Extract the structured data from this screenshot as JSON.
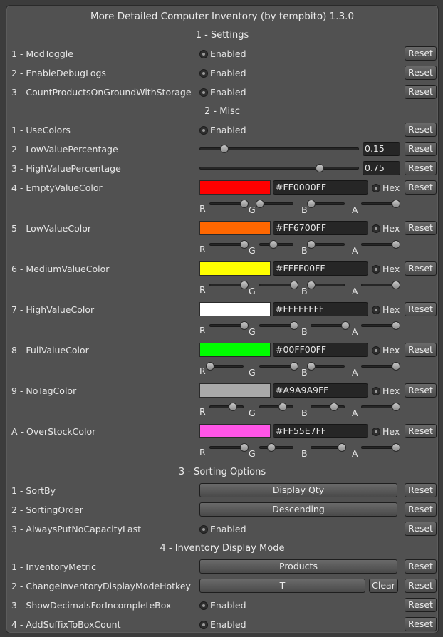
{
  "title": "More Detailed Computer Inventory (by tempbito) 1.3.0",
  "reset_label": "Reset",
  "enabled_label": "Enabled",
  "hex_label": "Hex",
  "channels": [
    "R",
    "G",
    "B",
    "A"
  ],
  "sections": {
    "settings": {
      "heading": "1 - Settings",
      "items": [
        {
          "label": "1 - ModToggle"
        },
        {
          "label": "2 - EnableDebugLogs"
        },
        {
          "label": "3 - CountProductsOnGroundWithStorage"
        }
      ]
    },
    "misc": {
      "heading": "2 - Misc",
      "use_colors": {
        "label": "1 - UseColors"
      },
      "low_value": {
        "label": "2 - LowValuePercentage",
        "value": "0.15",
        "fraction": 0.15
      },
      "high_value": {
        "label": "3 - HighValuePercentage",
        "value": "0.75",
        "fraction": 0.75
      },
      "colors": [
        {
          "label": "4 - EmptyValueColor",
          "hex": "#FF0000FF",
          "swatch": "#ff0000",
          "rgba": [
            1.0,
            0.0,
            0.0,
            1.0
          ]
        },
        {
          "label": "5 - LowValueColor",
          "hex": "#FF6700FF",
          "swatch": "#ff6700",
          "rgba": [
            1.0,
            0.4,
            0.0,
            1.0
          ]
        },
        {
          "label": "6 - MediumValueColor",
          "hex": "#FFFF00FF",
          "swatch": "#ffff00",
          "rgba": [
            1.0,
            1.0,
            0.0,
            1.0
          ]
        },
        {
          "label": "7 - HighValueColor",
          "hex": "#FFFFFFFF",
          "swatch": "#ffffff",
          "rgba": [
            1.0,
            1.0,
            1.0,
            1.0
          ]
        },
        {
          "label": "8 - FullValueColor",
          "hex": "#00FF00FF",
          "swatch": "#00ff00",
          "rgba": [
            0.0,
            1.0,
            0.0,
            1.0
          ]
        },
        {
          "label": "9 - NoTagColor",
          "hex": "#A9A9A9FF",
          "swatch": "#a9a9a9",
          "rgba": [
            0.66,
            0.66,
            0.66,
            1.0
          ]
        },
        {
          "label": "A - OverStockColor",
          "hex": "#FF55E7FF",
          "swatch": "#ff55e7",
          "rgba": [
            1.0,
            0.33,
            0.9,
            1.0
          ]
        }
      ]
    },
    "sorting": {
      "heading": "3 - Sorting Options",
      "sort_by": {
        "label": "1 - SortBy",
        "value": "Display Qty"
      },
      "order": {
        "label": "2 - SortingOrder",
        "value": "Descending"
      },
      "no_capacity": {
        "label": "3 - AlwaysPutNoCapacityLast"
      }
    },
    "display": {
      "heading": "4 - Inventory Display Mode",
      "metric": {
        "label": "1 - InventoryMetric",
        "value": "Products"
      },
      "hotkey": {
        "label": "2 - ChangeInventoryDisplayModeHotkey",
        "value": "T",
        "clear_label": "Clear"
      },
      "decimals": {
        "label": "3 - ShowDecimalsForIncompleteBox"
      },
      "suffix": {
        "label": "4 - AddSuffixToBoxCount"
      }
    }
  }
}
